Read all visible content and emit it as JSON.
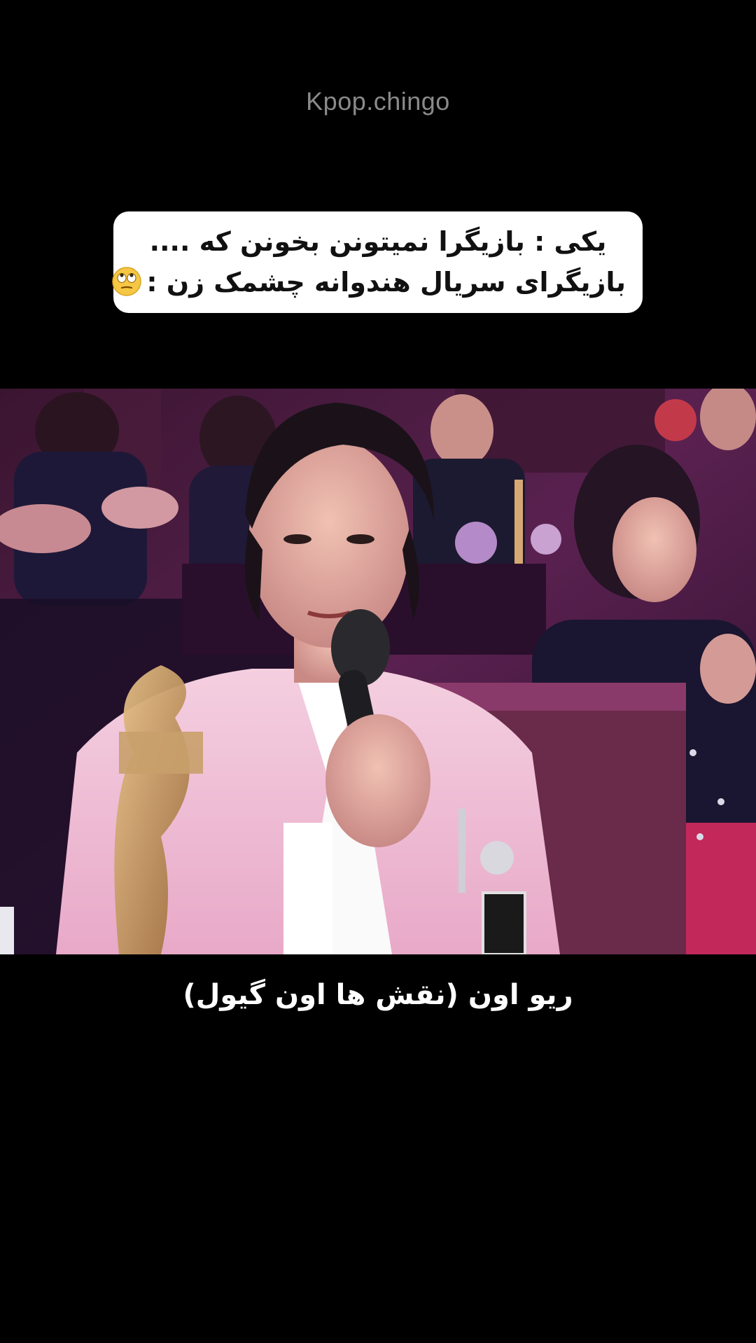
{
  "watermark": "Kpop.chingo",
  "caption": {
    "line1": "یکی : بازیگرا نمیتونن بخونن که ....",
    "line2": "بازیگرای سریال هندوانه چشمک زن :"
  },
  "emoji": "face-with-rolling-eyes",
  "subtitle": "ریو اون (نقش ها اون گیول)",
  "colors": {
    "background": "#000000",
    "caption_box": "#ffffff",
    "watermark": "#8a8a8a",
    "subtitle": "#ffffff",
    "stage_tint": "#7a2f6a"
  }
}
